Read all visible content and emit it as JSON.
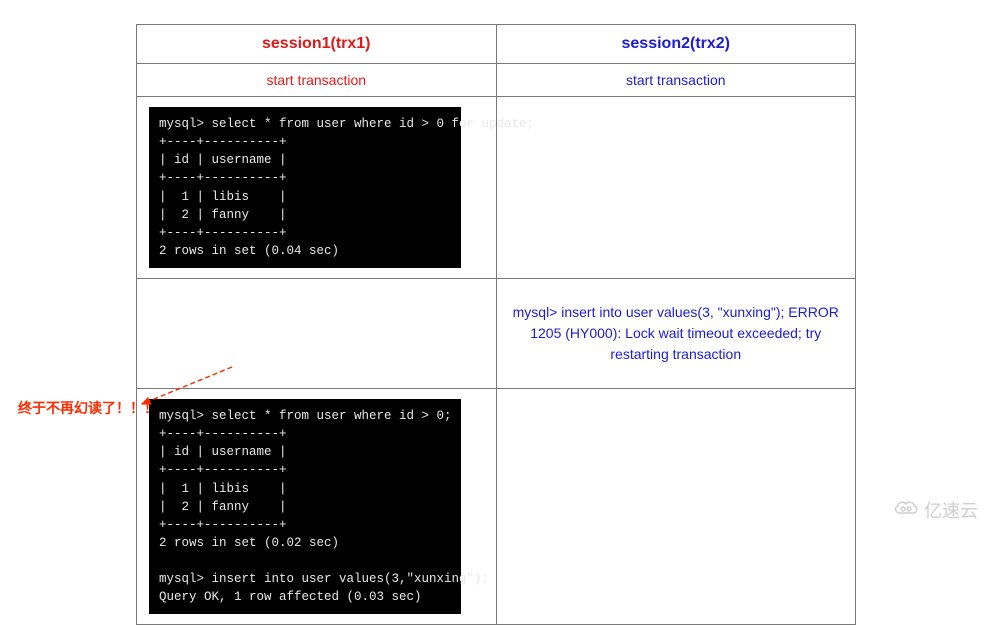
{
  "headers": {
    "col1": "session1(trx1)",
    "col2": "session2(trx2)"
  },
  "row2": {
    "col1": "start transaction",
    "col2": "start transaction"
  },
  "term1": "mysql> select * from user where id > 0 for update;\n+----+----------+\n| id | username |\n+----+----------+\n|  1 | libis    |\n|  2 | fanny    |\n+----+----------+\n2 rows in set (0.04 sec)",
  "row4_text": "mysql> insert into user values(3, \"xunxing\");\nERROR 1205 (HY000): Lock wait timeout exceeded; try restarting transaction",
  "term2": "mysql> select * from user where id > 0;\n+----+----------+\n| id | username |\n+----+----------+\n|  1 | libis    |\n|  2 | fanny    |\n+----+----------+\n2 rows in set (0.02 sec)\n\nmysql> insert into user values(3,\"xunxing\");\nQuery OK, 1 row affected (0.03 sec)",
  "annotation": "终于不再幻读了！！！",
  "watermark": "亿速云"
}
